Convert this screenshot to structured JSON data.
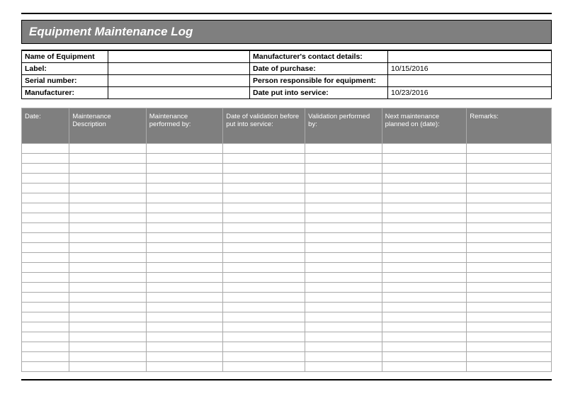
{
  "title": "Equipment Maintenance Log",
  "info": {
    "name_label": "Name of Equipment",
    "name_value": "",
    "mfr_contact_label": "Manufacturer's contact details:",
    "mfr_contact_value": "",
    "label_label": "Label:",
    "label_value": "",
    "date_purchase_label": "Date of purchase:",
    "date_purchase_value": "10/15/2016",
    "serial_label": "Serial number:",
    "serial_value": "",
    "person_label": "Person responsible for equipment:",
    "person_value": "",
    "mfr_label": "Manufacturer:",
    "mfr_value": "",
    "date_service_label": "Date put into service:",
    "date_service_value": "10/23/2016"
  },
  "log_columns": {
    "c1": "Date:",
    "c2": "Maintenance Description",
    "c3": "Maintenance performed by:",
    "c4": "Date of validation before put into service:",
    "c5": "Validation performed by:",
    "c6": "Next maintenance planned on (date):",
    "c7": "Remarks:"
  },
  "log_row_count": 23
}
